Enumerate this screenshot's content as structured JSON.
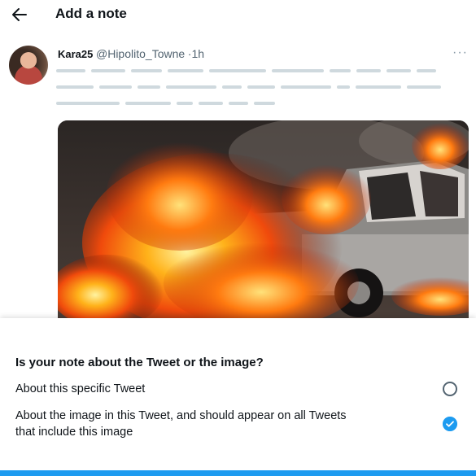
{
  "header": {
    "title": "Add a note",
    "back_icon": "arrow-left-icon"
  },
  "tweet": {
    "display_name": "Kara25",
    "handle": "@Hipolito_Towne",
    "separator": "·",
    "time": "1h",
    "more_icon": "more-horizontal-icon",
    "image_alt": "burning car"
  },
  "sheet": {
    "question": "Is your note about the Tweet or the image?",
    "options": [
      {
        "label": "About this specific Tweet",
        "selected": false
      },
      {
        "label": "About the image in this Tweet, and should appear on all Tweets that include this image",
        "selected": true
      }
    ]
  },
  "colors": {
    "accent": "#1d9bf0",
    "redaction": "#cfd9de",
    "secondary_text": "#536471"
  }
}
